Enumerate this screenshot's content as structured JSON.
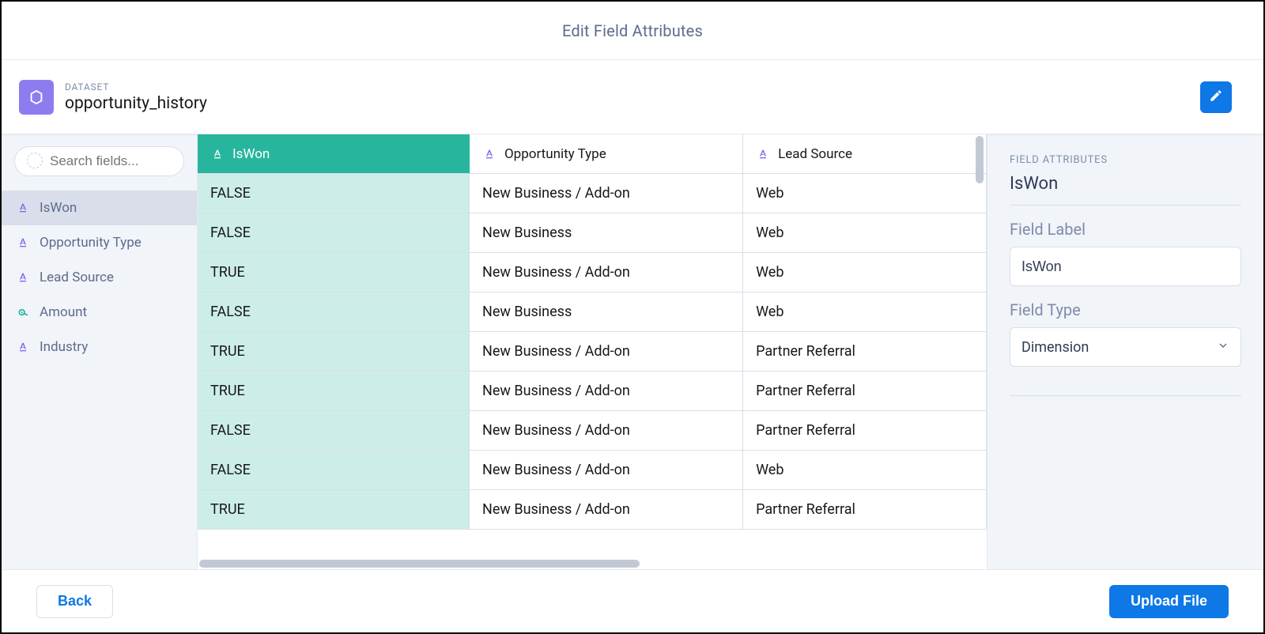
{
  "page_title": "Edit Field Attributes",
  "dataset": {
    "eyebrow": "DATASET",
    "name": "opportunity_history"
  },
  "search": {
    "placeholder": "Search fields..."
  },
  "fields": [
    {
      "label": "IsWon",
      "type": "dimension",
      "selected": true
    },
    {
      "label": "Opportunity Type",
      "type": "dimension",
      "selected": false
    },
    {
      "label": "Lead Source",
      "type": "dimension",
      "selected": false
    },
    {
      "label": "Amount",
      "type": "measure",
      "selected": false
    },
    {
      "label": "Industry",
      "type": "dimension",
      "selected": false
    }
  ],
  "table": {
    "columns": [
      "IsWon",
      "Opportunity Type",
      "Lead Source"
    ],
    "rows": [
      [
        "FALSE",
        "New Business / Add-on",
        "Web"
      ],
      [
        "FALSE",
        "New Business",
        "Web"
      ],
      [
        "TRUE",
        "New Business / Add-on",
        "Web"
      ],
      [
        "FALSE",
        "New Business",
        "Web"
      ],
      [
        "TRUE",
        "New Business / Add-on",
        "Partner Referral"
      ],
      [
        "TRUE",
        "New Business / Add-on",
        "Partner Referral"
      ],
      [
        "FALSE",
        "New Business / Add-on",
        "Partner Referral"
      ],
      [
        "FALSE",
        "New Business / Add-on",
        "Web"
      ],
      [
        "TRUE",
        "New Business / Add-on",
        "Partner Referral"
      ]
    ]
  },
  "attributes": {
    "eyebrow": "FIELD ATTRIBUTES",
    "field_name": "IsWon",
    "label_label": "Field Label",
    "label_value": "IsWon",
    "type_label": "Field Type",
    "type_value": "Dimension"
  },
  "footer": {
    "back": "Back",
    "upload": "Upload File"
  }
}
